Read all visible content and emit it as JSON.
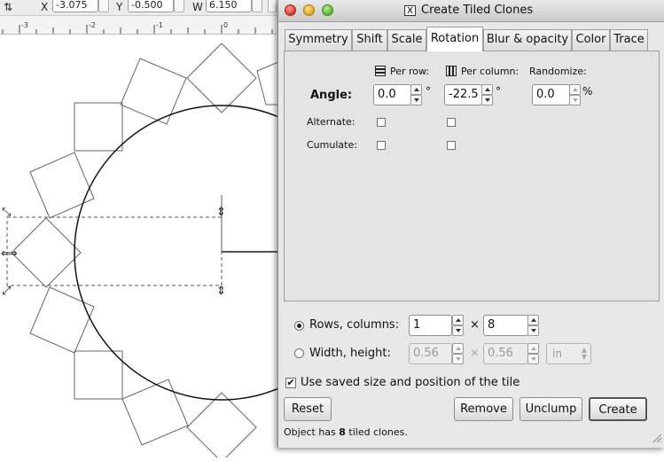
{
  "toolbar": {
    "x_label": "X",
    "x_value": "-3.075",
    "y_label": "Y",
    "y_value": "-0.500",
    "w_label": "W",
    "w_value": "6.150"
  },
  "ruler": {
    "labels": [
      "-3",
      "-2",
      "-1",
      "0"
    ]
  },
  "dialog": {
    "title": "Create Tiled Clones",
    "tabs": [
      {
        "label": "Symmetry"
      },
      {
        "label": "Shift"
      },
      {
        "label": "Scale"
      },
      {
        "label": "Rotation",
        "active": true
      },
      {
        "label": "Blur & opacity"
      },
      {
        "label": "Color"
      },
      {
        "label": "Trace"
      }
    ],
    "rotation": {
      "per_row_label": "Per row:",
      "per_column_label": "Per column:",
      "randomize_label": "Randomize:",
      "angle_label": "Angle:",
      "angle_per_row": "0.0",
      "angle_per_column": "-22.5",
      "angle_randomize": "0.0",
      "degree_unit": "°",
      "percent_unit": "%",
      "alternate_label": "Alternate:",
      "cumulate_label": "Cumulate:"
    },
    "rows_columns_label": "Rows, columns:",
    "rows_value": "1",
    "columns_value": "8",
    "times_sign": "×",
    "width_height_label": "Width, height:",
    "width_value": "0.56",
    "height_value": "0.56",
    "unit_value": "in",
    "use_saved_label": "Use saved size and position of the tile",
    "use_saved_checked": "✔",
    "buttons": {
      "reset": "Reset",
      "remove": "Remove",
      "unclump": "Unclump",
      "create": "Create"
    },
    "status": {
      "prefix": "Object has ",
      "count": "8",
      "suffix": " tiled clones."
    }
  }
}
